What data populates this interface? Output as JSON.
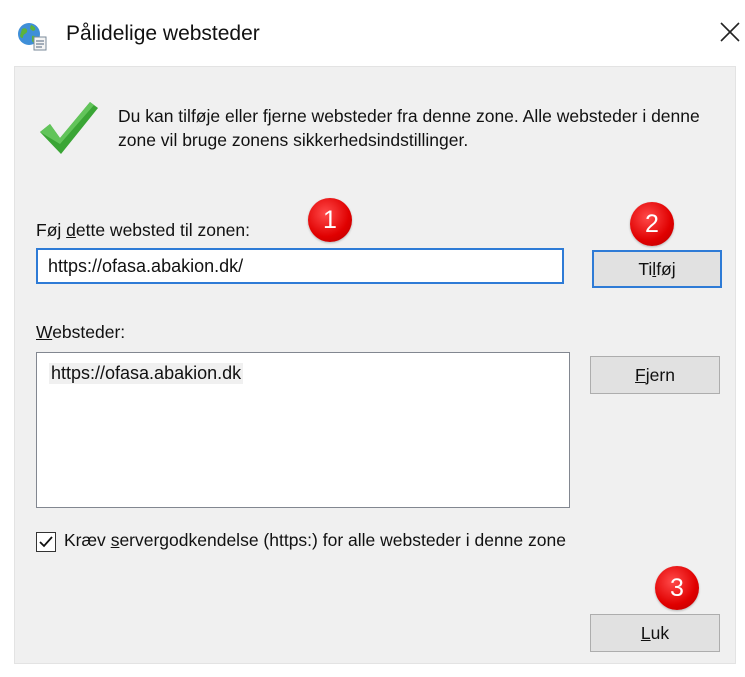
{
  "window": {
    "title": "Pålidelige websteder",
    "close_label": "Close"
  },
  "info_text": "Du kan tilføje eller fjerne websteder fra denne zone. Alle websteder i denne zone vil bruge zonens sikkerhedsindstillinger.",
  "add_site": {
    "label_prefix": "Føj ",
    "label_underline": "d",
    "label_suffix": "ette websted til zonen:",
    "value": "https://ofasa.abakion.dk/",
    "button_pre": "Ti",
    "button_underline": "l",
    "button_post": "føj"
  },
  "sites": {
    "label_underline": "W",
    "label_rest": "ebsteder:",
    "items": [
      "https://ofasa.abakion.dk"
    ],
    "remove_underline": "F",
    "remove_rest": "jern"
  },
  "require_https": {
    "checked": true,
    "label_pre": "Kræv ",
    "label_underline": "s",
    "label_post": "ervergodkendelse (https:) for alle websteder i denne zone"
  },
  "close_button": {
    "underline": "L",
    "rest": "uk"
  },
  "markers": [
    "1",
    "2",
    "3"
  ],
  "colors": {
    "accent": "#2e7bd6",
    "marker": "#e00000",
    "check": "#3aa535"
  }
}
